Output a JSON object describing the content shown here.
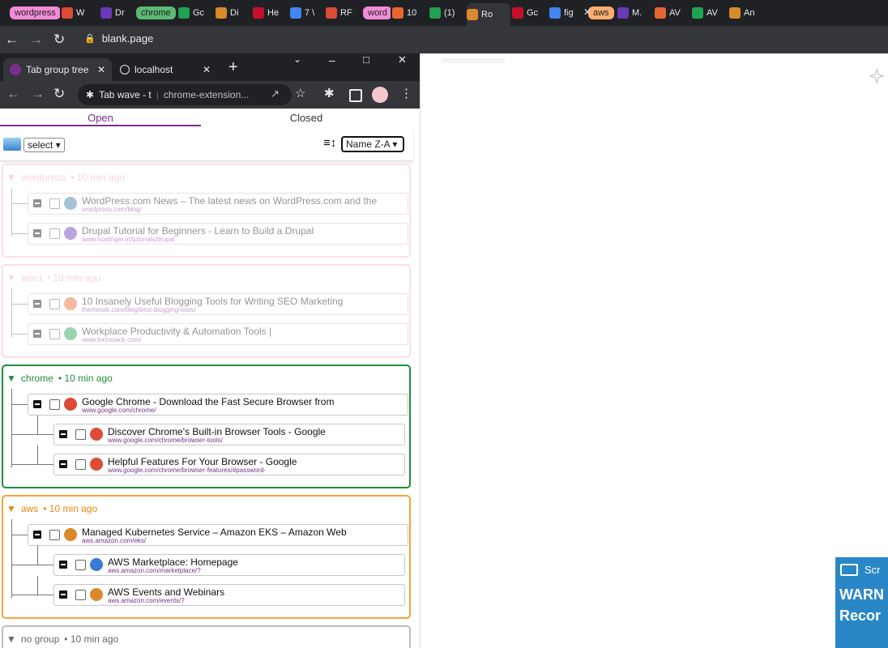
{
  "browser": {
    "tabs": [
      {
        "kind": "group",
        "label": "wordpress",
        "color": "#f28bd6"
      },
      {
        "kind": "tab",
        "label": "W",
        "icon": "wordpress-icon"
      },
      {
        "kind": "tab",
        "label": "Dr",
        "icon": "drupal-icon"
      },
      {
        "kind": "group",
        "label": "chrome",
        "color": "#5bb974"
      },
      {
        "kind": "tab",
        "label": "Gc",
        "icon": "chrome-icon"
      },
      {
        "kind": "tab",
        "label": "Di",
        "icon": "chrome-icon"
      },
      {
        "kind": "tab",
        "label": "He",
        "icon": "chrome-icon"
      },
      {
        "kind": "tab",
        "label": "7 \\",
        "icon": "puzzle-icon"
      },
      {
        "kind": "tab",
        "label": "RF",
        "icon": "rf-icon"
      },
      {
        "kind": "group",
        "label": "word",
        "color": "#f28bd6"
      },
      {
        "kind": "tab",
        "label": "10",
        "icon": "flame-icon"
      },
      {
        "kind": "tab",
        "label": "(1)",
        "icon": "formstack-icon"
      },
      {
        "kind": "tab",
        "label": "Ro",
        "icon": "tab-icon"
      },
      {
        "kind": "tab",
        "label": "Gc",
        "icon": "mail-icon"
      },
      {
        "kind": "tab",
        "label": "fig",
        "icon": "google-icon"
      },
      {
        "kind": "group",
        "label": "aws",
        "color": "#fcad70"
      },
      {
        "kind": "tab",
        "label": "M.",
        "icon": "aws-icon"
      },
      {
        "kind": "tab",
        "label": "AV",
        "icon": "aws-icon"
      },
      {
        "kind": "tab",
        "label": "AV",
        "icon": "aws-icon"
      },
      {
        "kind": "tab",
        "label": "An",
        "icon": "amazon-icon"
      }
    ],
    "address": "blank.page"
  },
  "popup": {
    "tabs": [
      {
        "label": "Tab group tree"
      },
      {
        "label": "localhost"
      }
    ],
    "omnibox": {
      "title": "Tab wave - t",
      "url": "chrome-extension..."
    },
    "segments": {
      "open": "Open",
      "closed": "Closed"
    },
    "controls": {
      "select_value": "select",
      "sort_value": "Name Z-A"
    },
    "groups": [
      {
        "name": "wordpress",
        "meta": "10 min ago",
        "color": "#f5b8c9",
        "text_color": "#f5a3b8",
        "faded": true,
        "rows": [
          {
            "level": 0,
            "title": "WordPress.com News – The latest news on WordPress.com and the",
            "url": "wordpress.com/blog/",
            "fav": "#3878a8"
          },
          {
            "level": 0,
            "title": "Drupal Tutorial for Beginners - Learn to Build a Drupal",
            "url": "www.hostinger.in/tutorials/drupal",
            "fav": "#673ab7"
          }
        ]
      },
      {
        "name": "word",
        "meta": "10 min ago",
        "color": "#f5b8c9",
        "text_color": "#f5a3b8",
        "faded": true,
        "rows": [
          {
            "level": 0,
            "title": "10 Insanely Useful Blogging Tools for Writing SEO Marketing",
            "url": "themeisle.com/blog/best-blogging-tools/",
            "fav": "#e8662f"
          },
          {
            "level": 0,
            "title": "Workplace Productivity & Automation Tools |",
            "url": "www.formstack.com/",
            "fav": "#21a152"
          }
        ]
      },
      {
        "name": "chrome",
        "meta": "10 min ago",
        "color": "#1e8e3e",
        "text_color": "#1e8e3e",
        "faded": false,
        "rows": [
          {
            "level": 0,
            "title": "Google Chrome - Download the Fast Secure Browser from",
            "url": "www.google.com/chrome/",
            "fav": "#dd4b39"
          },
          {
            "level": 1,
            "title": "Discover Chrome's Built-in Browser Tools - Google",
            "url": "www.google.com/chrome/browser-tools/",
            "fav": "#dd4b39"
          },
          {
            "level": 1,
            "title": "Helpful Features For Your Browser - Google",
            "url": "www.google.com/chrome/browser-features/#password-",
            "fav": "#dd4b39"
          }
        ]
      },
      {
        "name": "aws",
        "meta": "10 min ago",
        "color": "#f0a636",
        "text_color": "#e8890c",
        "faded": false,
        "rows": [
          {
            "level": 0,
            "title": "Managed Kubernetes Service – Amazon EKS – Amazon Web",
            "url": "aws.amazon.com/eks/",
            "fav": "#d98a2b"
          },
          {
            "level": 1,
            "title": "AWS Marketplace: Homepage",
            "url": "aws.amazon.com/marketplace/?",
            "fav": "#3a7bd5"
          },
          {
            "level": 1,
            "title": "AWS Events and Webinars",
            "url": "aws.amazon.com/events/?",
            "fav": "#d98a2b"
          }
        ]
      },
      {
        "name": "no group",
        "meta": "10 min ago",
        "color": "#bdbdbd",
        "text_color": "#666666",
        "faded": false,
        "rows": []
      }
    ]
  },
  "banner": {
    "line1": "Scr",
    "line2": "WARN",
    "line3": "Recor"
  }
}
